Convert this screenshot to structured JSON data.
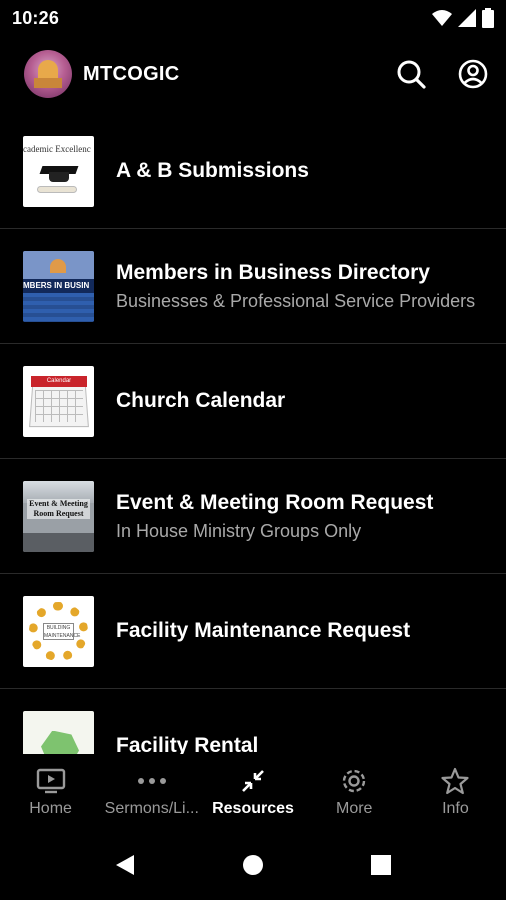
{
  "status_bar": {
    "time": "10:26"
  },
  "app_bar": {
    "title": "MTCOGIC"
  },
  "items": [
    {
      "title": "A & B Submissions",
      "subtitle": "",
      "thumb_text": "cademic Excellenc"
    },
    {
      "title": "Members in Business Directory",
      "subtitle": "Businesses & Professional Service Providers",
      "thumb_text": "MBERS IN BUSIN"
    },
    {
      "title": "Church Calendar",
      "subtitle": "",
      "thumb_text": "Calendar"
    },
    {
      "title": "Event & Meeting Room Request",
      "subtitle": "In House Ministry Groups Only",
      "thumb_text": "Event & Meeting Room Request"
    },
    {
      "title": "Facility Maintenance Request",
      "subtitle": "",
      "thumb_text": "BUILDING MAINTENANCE"
    },
    {
      "title": "Facility Rental",
      "subtitle": ""
    }
  ],
  "bottom_nav": [
    {
      "label": "Home",
      "icon": "tv-icon"
    },
    {
      "label": "Sermons/Li...",
      "icon": "more-horizontal-icon"
    },
    {
      "label": "Resources",
      "icon": "resources-icon"
    },
    {
      "label": "More",
      "icon": "gear-icon"
    },
    {
      "label": "Info",
      "icon": "star-icon"
    }
  ],
  "active_tab": "Resources"
}
